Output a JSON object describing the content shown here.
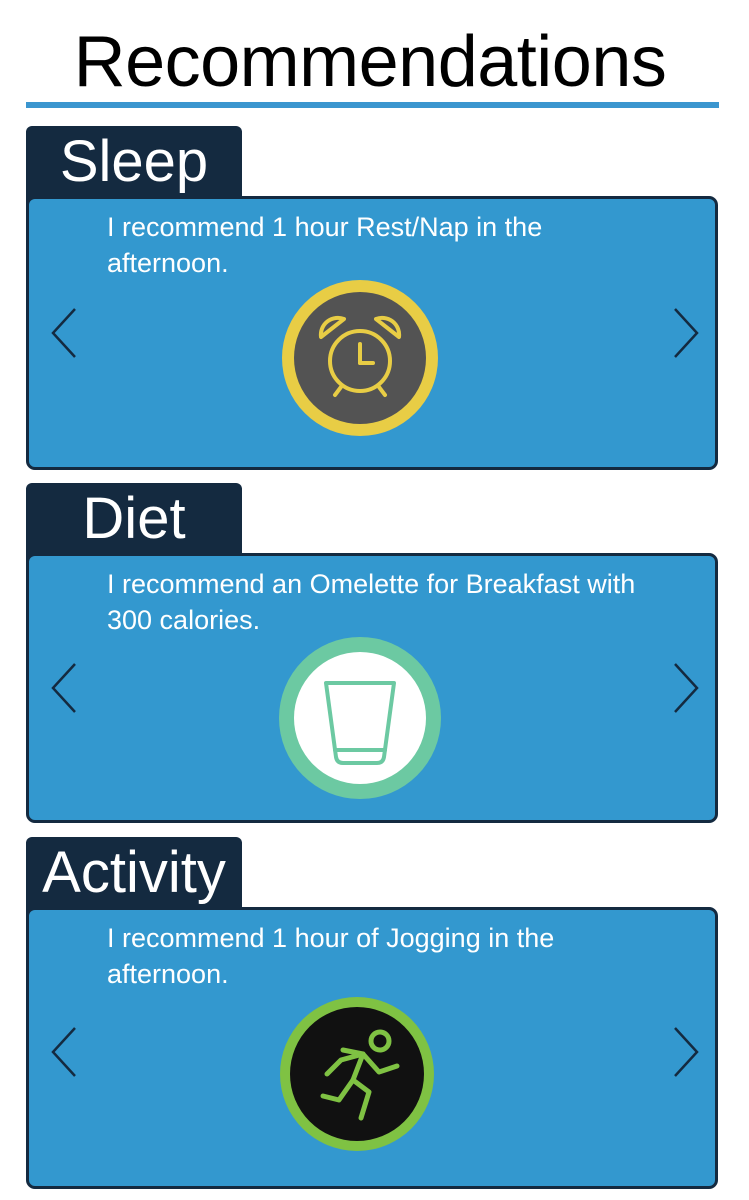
{
  "page": {
    "title": "Recommendations"
  },
  "sections": [
    {
      "tab_label": "Sleep",
      "text": "I recommend 1 hour Rest/Nap in the afternoon.",
      "icon": "alarm-clock-icon",
      "icon_colors": {
        "ring": "#e8cd45",
        "fill": "#535353",
        "glyph": "#e8cd45"
      }
    },
    {
      "tab_label": "Diet",
      "text": "I recommend an Omelette for Breakfast with 300 calories.",
      "icon": "glass-icon",
      "icon_colors": {
        "ring": "#6cc9a2",
        "fill": "#ffffff",
        "glyph": "#6cc9a2"
      }
    },
    {
      "tab_label": "Activity",
      "text": "I recommend 1 hour of Jogging in the afternoon.",
      "icon": "running-person-icon",
      "icon_colors": {
        "ring": "#7fc243",
        "fill": "#111111",
        "glyph": "#7fc243"
      }
    }
  ],
  "colors": {
    "accent": "#3b96cf",
    "card_bg": "#3398cf",
    "tab_bg": "#142a40",
    "text": "#ffffff"
  }
}
